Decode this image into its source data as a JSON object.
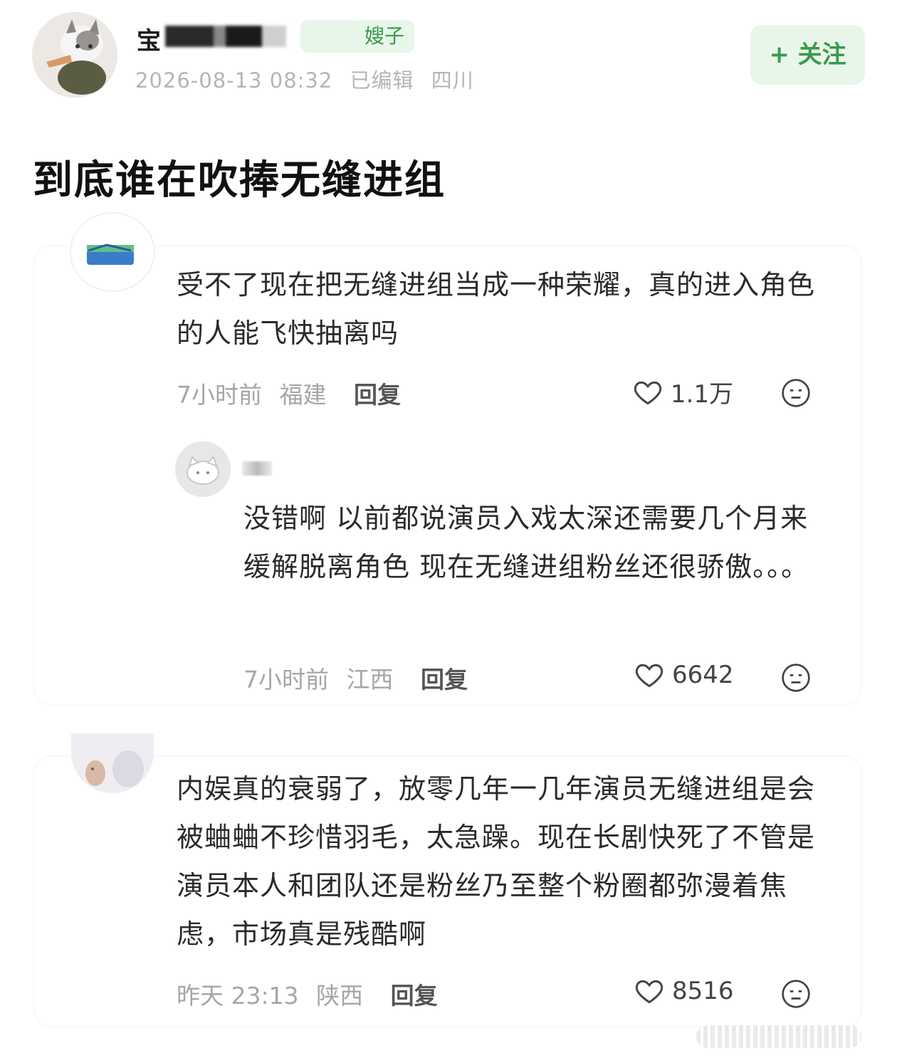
{
  "post": {
    "author_name": "宝",
    "badge_text": "嫂子",
    "timestamp": "2026-08-13 08:32",
    "edited": "已编辑",
    "location": "四川",
    "follow_label": "+ 关注",
    "title": "到底谁在吹捧无缝进组"
  },
  "comments": [
    {
      "text": "受不了现在把无缝进组当成一种荣耀，真的进入角色的人能飞快抽离吗",
      "time": "7小时前",
      "location": "福建",
      "reply_label": "回复",
      "likes": "1.1万",
      "replies": [
        {
          "text": "没错啊 以前都说演员入戏太深还需要几个月来缓解脱离角色 现在无缝进组粉丝还很骄傲。。。",
          "time": "7小时前",
          "location": "江西",
          "reply_label": "回复",
          "likes": "6642"
        }
      ]
    },
    {
      "text": "内娱真的衰弱了，放零几年一几年演员无缝进组是会被蛐蛐不珍惜羽毛，太急躁。现在长剧快死了不管是演员本人和团队还是粉丝乃至整个粉圈都弥漫着焦虑，市场真是残酷啊",
      "time": "昨天 23:13",
      "location": "陕西",
      "reply_label": "回复",
      "likes": "8516"
    }
  ],
  "colors": {
    "accent_green": "#3b9a4b",
    "accent_green_bg": "#e8f6ea",
    "meta_gray": "#a6a6a6"
  }
}
